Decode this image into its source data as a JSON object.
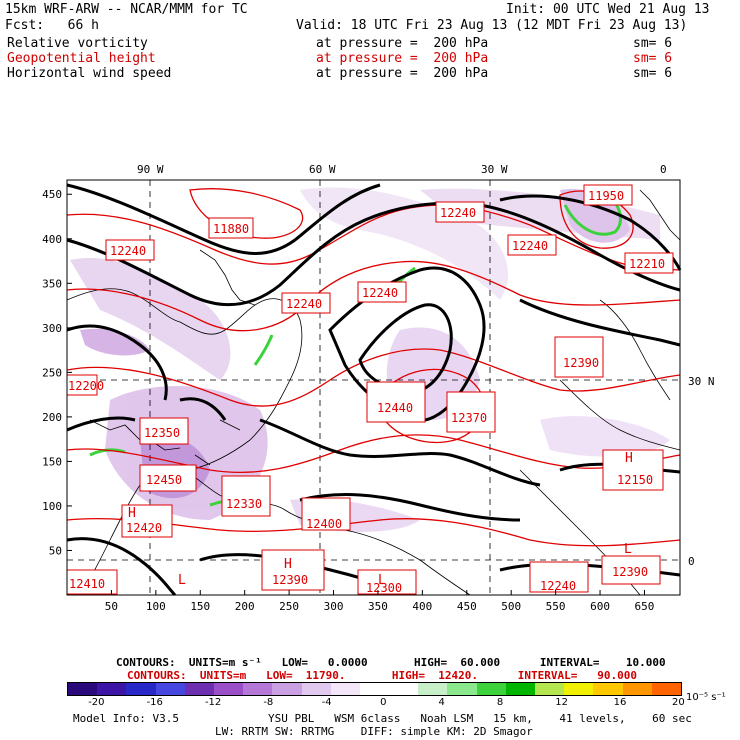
{
  "header": {
    "model_line": "15km WRF-ARW -- NCAR/MMM for TC",
    "init": "Init: 00 UTC Wed 21 Aug 13",
    "fcst": "Fcst:   66 h",
    "valid": "Valid: 18 UTC Fri 23 Aug 13 (12 MDT Fri 23 Aug 13)",
    "fields": [
      {
        "name": "Relative vorticity",
        "level": "at pressure =  200 hPa",
        "sm": "sm= 6",
        "color": "#000000"
      },
      {
        "name": "Geopotential height",
        "level": "at pressure =  200 hPa",
        "sm": "sm= 6",
        "color": "#d00000"
      },
      {
        "name": "Horizontal wind speed",
        "level": "at pressure =  200 hPa",
        "sm": "sm= 6",
        "color": "#000000"
      }
    ]
  },
  "map": {
    "top_labels": [
      "90 W",
      "60 W",
      "30 W",
      "0"
    ],
    "right_labels": [
      "30 N",
      "0"
    ],
    "x_ticks": [
      "50",
      "100",
      "150",
      "200",
      "250",
      "300",
      "350",
      "400",
      "450",
      "500",
      "550",
      "600",
      "650"
    ],
    "y_ticks": [
      "450",
      "400",
      "350",
      "300",
      "250",
      "200",
      "150",
      "100",
      "50"
    ],
    "height_labels": [
      "11880",
      "12240",
      "12240",
      "12240",
      "12240",
      "12240",
      "12210",
      "11950",
      "12390",
      "12370",
      "12440",
      "12390",
      "12420",
      "12410",
      "12390",
      "12300",
      "12350",
      "12450",
      "12400",
      "12330",
      "12150",
      "12240",
      "12200"
    ],
    "high_low_markers": [
      "H",
      "L",
      "L",
      "L",
      "H",
      "H"
    ]
  },
  "footer": {
    "contours1": "CONTOURS:  UNITS=m s⁻¹   LOW=   0.0000       HIGH=  60.000      INTERVAL=    10.000",
    "contours2": "CONTOURS:  UNITS=m   LOW=  11790.       HIGH=  12420.      INTERVAL=   90.000",
    "colorbar_labels": [
      "-20",
      "-16",
      "-12",
      "-8",
      "-4",
      "0",
      "4",
      "8",
      "12",
      "16",
      "20"
    ],
    "colorbar_units": "10⁻⁵ s⁻¹",
    "colorbar_colors": [
      "#2a0a7a",
      "#3c14a6",
      "#2828c8",
      "#4646e0",
      "#6e2eb0",
      "#9a4ec8",
      "#b678d8",
      "#caa0e2",
      "#e0c8ee",
      "#f2e6f8",
      "#ffffff",
      "#ffffff",
      "#c8f0c8",
      "#8ce88c",
      "#3cd23c",
      "#00b400",
      "#b4e650",
      "#f0f000",
      "#ffc800",
      "#ff9600",
      "#ff6400"
    ],
    "model_info": "Model Info: V3.5",
    "physics1": "YSU PBL   WSM 6class   Noah LSM   15 km,    41 levels,    60 sec",
    "physics2": "LW: RRTM SW: RRTMG    DIFF: simple KM: 2D Smagor"
  }
}
